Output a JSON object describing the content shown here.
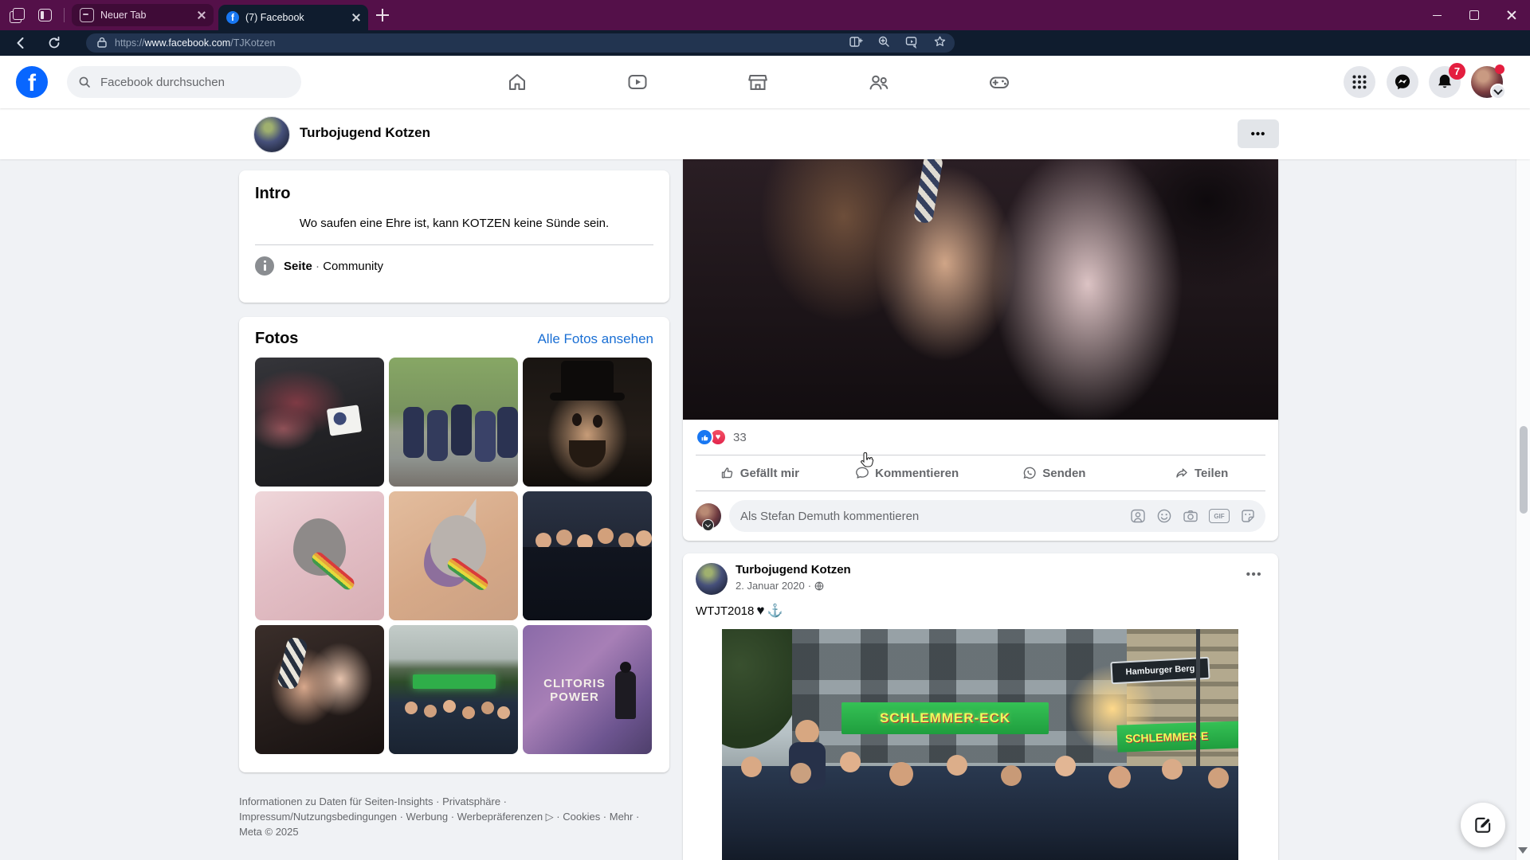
{
  "browser": {
    "tabs": [
      {
        "label": "Neuer Tab"
      },
      {
        "label": "(7) Facebook"
      }
    ],
    "url": {
      "scheme": "https://",
      "host": "www.facebook.com",
      "path": "/TJKotzen"
    }
  },
  "header": {
    "search_placeholder": "Facebook durchsuchen",
    "notification_badge": "7"
  },
  "page_bar": {
    "title": "Turbojugend Kotzen",
    "more_label": "•••"
  },
  "intro": {
    "heading": "Intro",
    "motto": "Wo saufen eine Ehre ist, kann KOTZEN keine Sünde sein.",
    "category_label": "Seite",
    "separator": "·",
    "category_value": "Community"
  },
  "photos": {
    "heading": "Fotos",
    "see_all": "Alle Fotos ansehen",
    "mural_line1": "CLITORIS",
    "mural_line2": "POWER"
  },
  "left_footer": {
    "links": "Informationen zu Daten für Seiten-Insights · Privatsphäre · Impressum/Nutzungsbedingungen · Werbung · Werbepräferenzen ▷ · Cookies · Mehr · Meta © 2025"
  },
  "post1": {
    "reaction_count": "33",
    "love_glyph": "♥",
    "like_label": "Gefällt mir",
    "comment_label": "Kommentieren",
    "send_label": "Senden",
    "share_label": "Teilen",
    "comment_placeholder": "Als Stefan Demuth kommentieren",
    "gif_label": "GIF"
  },
  "post2": {
    "author": "Turbojugend Kotzen",
    "date": "2. Januar 2020",
    "separator": "·",
    "more_label": "•••",
    "text": "WTJT2018",
    "emoji_heart": "♥",
    "emoji_anchor": "⚓",
    "image_signs": {
      "shop_left": "SCHLEMMER-ECK",
      "shop_right": "SCHLEMMER-E",
      "street": "Hamburger Berg"
    }
  },
  "icons": {
    "browser": [
      "tab-stack-icon",
      "vertical-tabs-icon",
      "back-icon",
      "refresh-icon",
      "lock-icon",
      "split-screen-icon",
      "zoom-icon",
      "capture-icon",
      "favorite-star-icon",
      "extension-icons",
      "profile-avatar",
      "copilot-icon"
    ],
    "facebook_nav": [
      "home-icon",
      "watch-icon",
      "marketplace-icon",
      "groups-icon",
      "gaming-icon"
    ],
    "facebook_right": [
      "apps-grid-icon",
      "messenger-icon",
      "notifications-bell-icon",
      "account-avatar"
    ],
    "post_actions": [
      "like-thumb-icon",
      "comment-bubble-icon",
      "send-whatsapp-icon",
      "share-arrow-icon"
    ],
    "comment_box": [
      "avatar-sticker-icon",
      "emoji-icon",
      "camera-icon",
      "gif-icon",
      "sticker-icon"
    ]
  }
}
